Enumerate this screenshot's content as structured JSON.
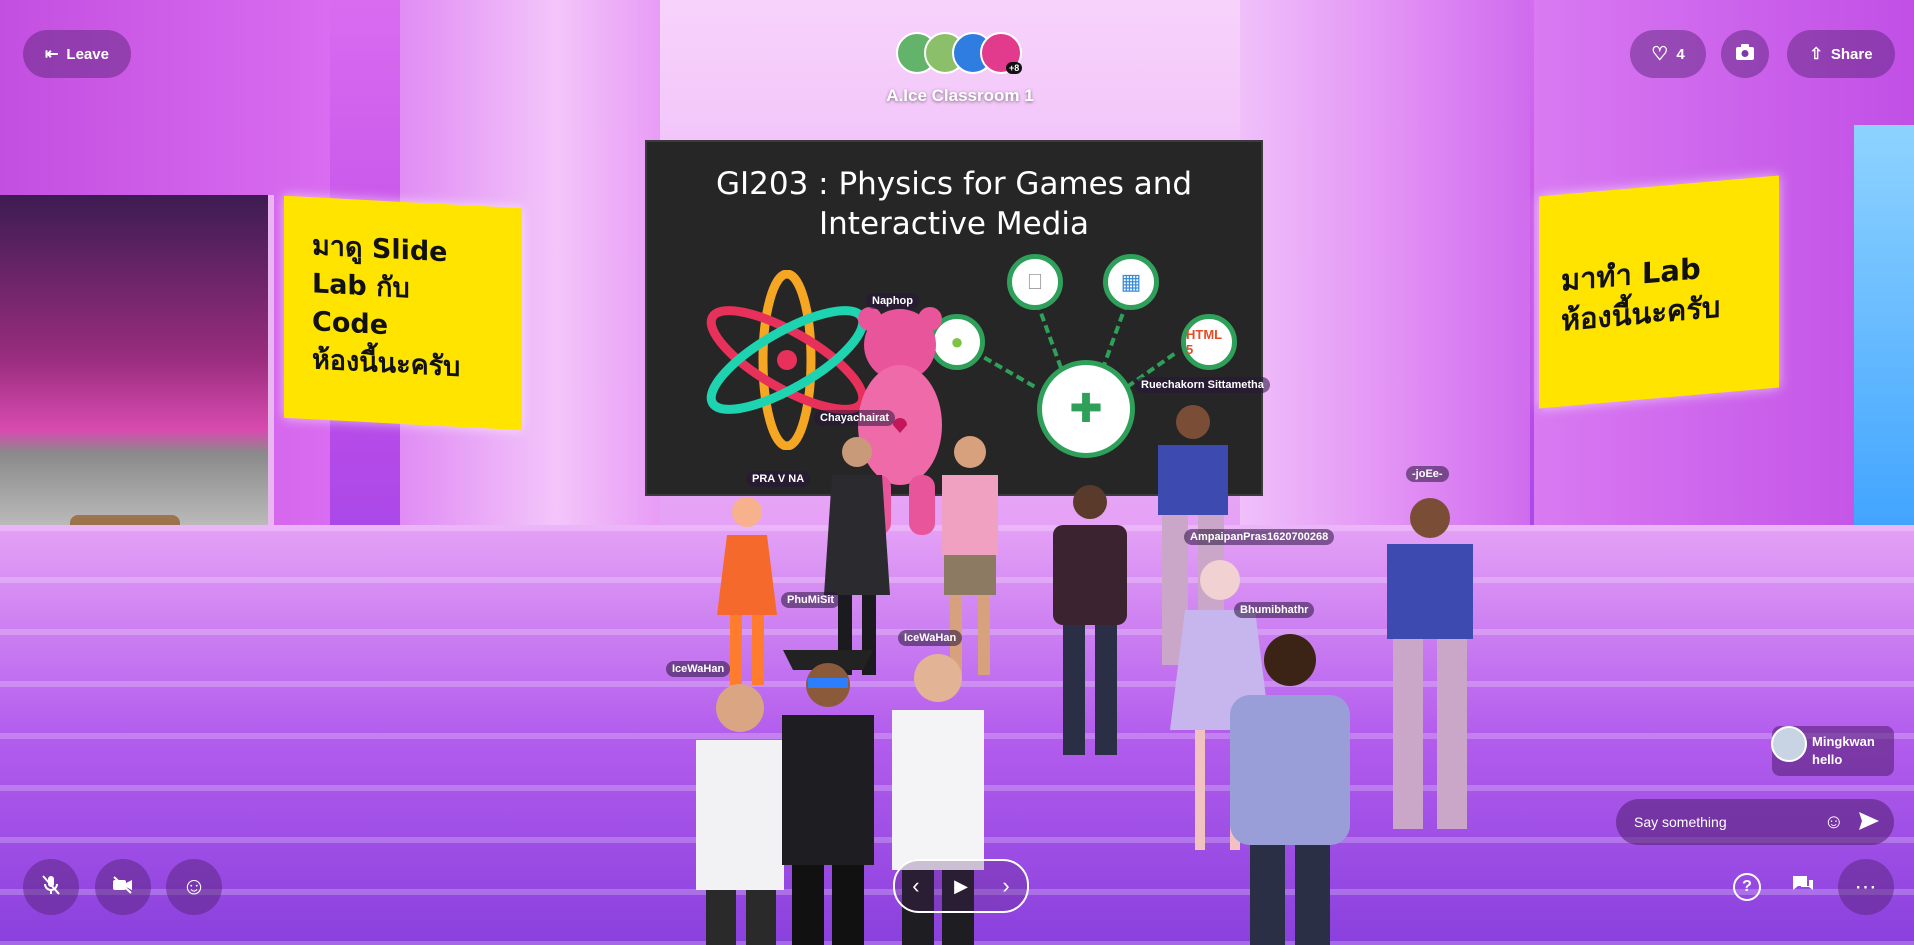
{
  "header": {
    "leave_label": "Leave",
    "like_count": "4",
    "share_label": "Share",
    "room_title": "A.Ice Classroom 1",
    "extra_participants": "+8"
  },
  "scene": {
    "sign_left": "มาดู Slide\nLab กับ\nCode\nห้องนี้นะครับ",
    "sign_right": "มาทำ Lab\nห้องนี้นะครับ",
    "slide_title_line1": "GI203 : Physics for Games and",
    "slide_title_line2": "Interactive Media",
    "slide_icons": {
      "html": "HTML 5"
    },
    "name_tags": {
      "naphop": "Naphop",
      "chayachairat": "Chayachairat",
      "ruechakorn": "Ruechakorn Sittametha",
      "pravna": "PRA V NA",
      "joee": "-joEe-",
      "ampaipan": "AmpaipanPras1620700268",
      "bhumibhathr": "Bhumibhathr",
      "phumisit": "PhuMiSit",
      "icewahan_center": "IceWaHan",
      "icewahan_left": "IceWaHan"
    }
  },
  "chat": {
    "sender": "Mingkwan",
    "message": "hello",
    "input_placeholder": "Say something"
  },
  "colors": {
    "accent_yellow": "#ffe400",
    "slide_bg": "#262626",
    "slide_green": "#2ea05a",
    "scene_purple": "#b35ded"
  }
}
